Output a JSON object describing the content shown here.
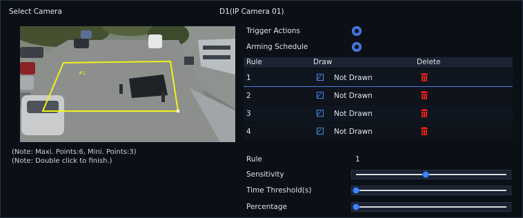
{
  "header": {
    "select_camera": "Select Camera",
    "camera_title": "D1(IP Camera 01)"
  },
  "video": {
    "zone_label": "#1",
    "zone_color": "#f2f21a"
  },
  "notes": {
    "line1": "(Note: Maxi. Points:6, Mini. Points:3)",
    "line2": "(Note: Double click to finish.)"
  },
  "settings": {
    "trigger_actions": "Trigger Actions",
    "arming_schedule": "Arming Schedule",
    "gear_icon_color": "#3b6fd8"
  },
  "table": {
    "headers": {
      "rule": "Rule",
      "draw": "Draw",
      "delete": "Delete"
    },
    "rows": [
      {
        "rule": "1",
        "status": "Not Drawn"
      },
      {
        "rule": "2",
        "status": "Not Drawn"
      },
      {
        "rule": "3",
        "status": "Not Drawn"
      },
      {
        "rule": "4",
        "status": "Not Drawn"
      }
    ],
    "selected_row": "1",
    "delete_icon_color": "#e8201a",
    "draw_icon_color": "#4a8ef0"
  },
  "rule_settings": {
    "rule_label": "Rule",
    "rule_value": "1",
    "sensitivity_label": "Sensitivity",
    "sensitivity_fraction": 0.48,
    "time_threshold_label": "Time Threshold(s)",
    "time_threshold_fraction": 0.0,
    "percentage_label": "Percentage",
    "percentage_fraction": 0.0
  }
}
